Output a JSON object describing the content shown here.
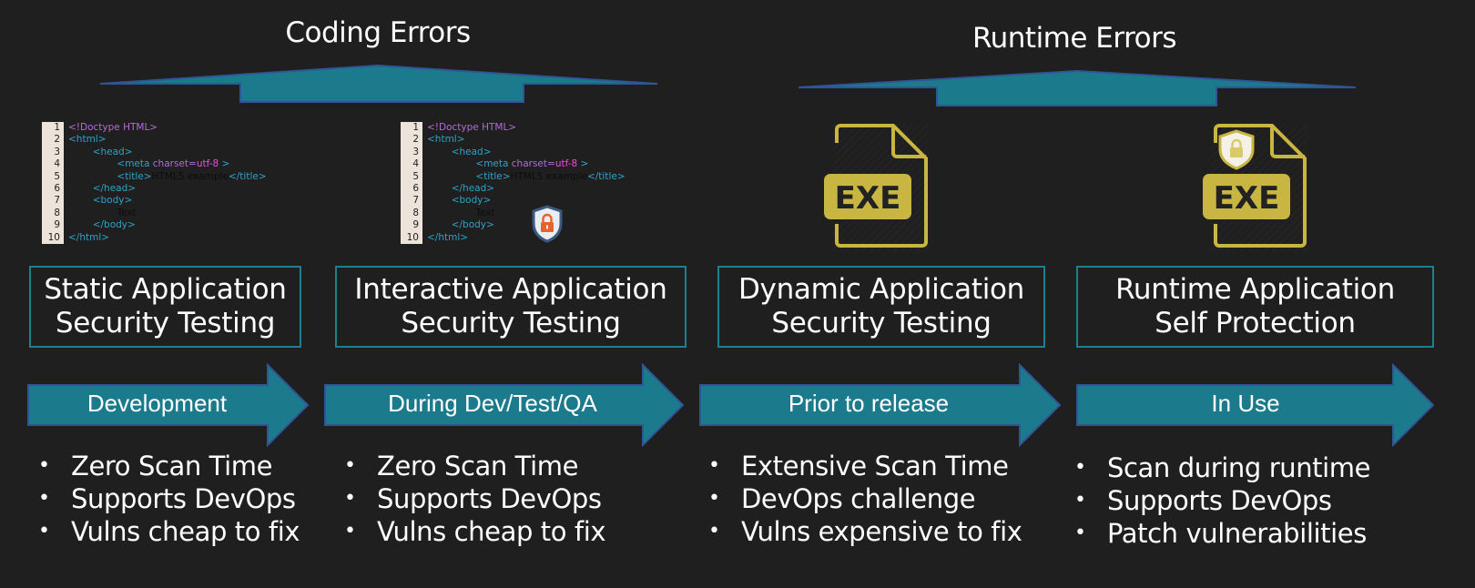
{
  "groups": [
    {
      "title": "Coding Errors"
    },
    {
      "title": "Runtime Errors"
    }
  ],
  "code_snippet": {
    "line_numbers": [
      "1",
      "2",
      "3",
      "4",
      "5",
      "6",
      "7",
      "8",
      "9",
      "10"
    ],
    "lines": [
      {
        "indent": "",
        "parts": [
          {
            "cls": "purple",
            "t": "<!Doctype HTML>"
          }
        ]
      },
      {
        "indent": "",
        "parts": [
          {
            "cls": "tag",
            "t": "<html>"
          }
        ]
      },
      {
        "indent": "        ",
        "parts": [
          {
            "cls": "tag",
            "t": "<head>"
          }
        ]
      },
      {
        "indent": "                ",
        "parts": [
          {
            "cls": "tag",
            "t": "<meta "
          },
          {
            "cls": "purple",
            "t": "charset="
          },
          {
            "cls": "pink",
            "t": "utf-8"
          },
          {
            "cls": "tag",
            "t": " >"
          }
        ]
      },
      {
        "indent": "                ",
        "parts": [
          {
            "cls": "tag",
            "t": "<title>"
          },
          {
            "cls": "txt",
            "t": "HTML5 example"
          },
          {
            "cls": "tag",
            "t": "</title>"
          }
        ]
      },
      {
        "indent": "        ",
        "parts": [
          {
            "cls": "tag",
            "t": "</head>"
          }
        ]
      },
      {
        "indent": "        ",
        "parts": [
          {
            "cls": "tag",
            "t": "<body>"
          }
        ]
      },
      {
        "indent": "                ",
        "parts": [
          {
            "cls": "txt",
            "t": "Text"
          }
        ]
      },
      {
        "indent": "        ",
        "parts": [
          {
            "cls": "tag",
            "t": "</body>"
          }
        ]
      },
      {
        "indent": "",
        "parts": [
          {
            "cls": "tag",
            "t": "</html>"
          }
        ]
      }
    ]
  },
  "exe_label": "EXE",
  "columns": [
    {
      "title_line1": "Static Application",
      "title_line2": "Security Testing",
      "phase": "Development",
      "bullets": [
        "Zero Scan Time",
        "Supports DevOps",
        "Vulns cheap to fix"
      ],
      "icon": "code-snippet-icon"
    },
    {
      "title_line1": "Interactive Application",
      "title_line2": "Security Testing",
      "phase": "During Dev/Test/QA",
      "bullets": [
        "Zero Scan Time",
        "Supports DevOps",
        "Vulns cheap to fix"
      ],
      "icon": "code-snippet-with-shield-icon"
    },
    {
      "title_line1": "Dynamic Application",
      "title_line2": "Security Testing",
      "phase": "Prior to release",
      "bullets": [
        "Extensive Scan Time",
        "DevOps challenge",
        "Vulns expensive to fix"
      ],
      "icon": "exe-file-icon"
    },
    {
      "title_line1": "Runtime Application",
      "title_line2": "Self Protection",
      "phase": "In Use",
      "bullets": [
        "Scan during runtime",
        "Supports DevOps",
        "Patch vulnerabilities"
      ],
      "icon": "exe-file-with-shield-icon"
    }
  ],
  "colors": {
    "background": "#1f1f1f",
    "teal": "#1b7b8c",
    "teal_border": "#2f5597",
    "exe_gold": "#c9b541",
    "shield_orange": "#e8632b"
  }
}
